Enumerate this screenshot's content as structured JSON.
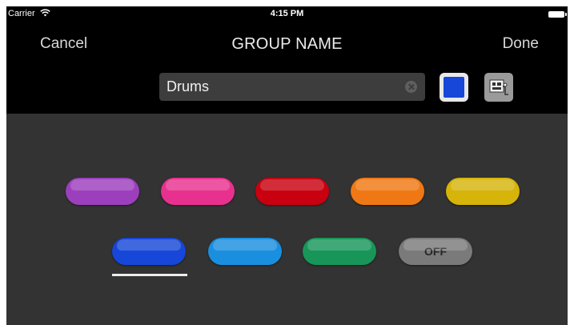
{
  "status_bar": {
    "carrier": "Carrier",
    "time": "4:15 PM"
  },
  "nav": {
    "cancel": "Cancel",
    "title": "GROUP NAME",
    "done": "Done"
  },
  "name_field": {
    "value": "Drums",
    "placeholder": ""
  },
  "selected_color": "#1747d8",
  "icons": {
    "wifi": "wifi-icon",
    "battery": "battery-icon",
    "clear": "clear-text-icon",
    "image": "image-icon"
  },
  "color_options": [
    {
      "id": "purple",
      "color": "#9c3fbd"
    },
    {
      "id": "pink",
      "color": "#e8318f"
    },
    {
      "id": "red",
      "color": "#c8000f"
    },
    {
      "id": "orange",
      "color": "#f07814"
    },
    {
      "id": "yellow",
      "color": "#d6b40a"
    },
    {
      "id": "blue",
      "color": "#1747d8",
      "selected": true
    },
    {
      "id": "light-blue",
      "color": "#1a8fe0"
    },
    {
      "id": "green",
      "color": "#18965a"
    },
    {
      "id": "off",
      "color": "#7a7a7a",
      "label": "OFF"
    }
  ]
}
